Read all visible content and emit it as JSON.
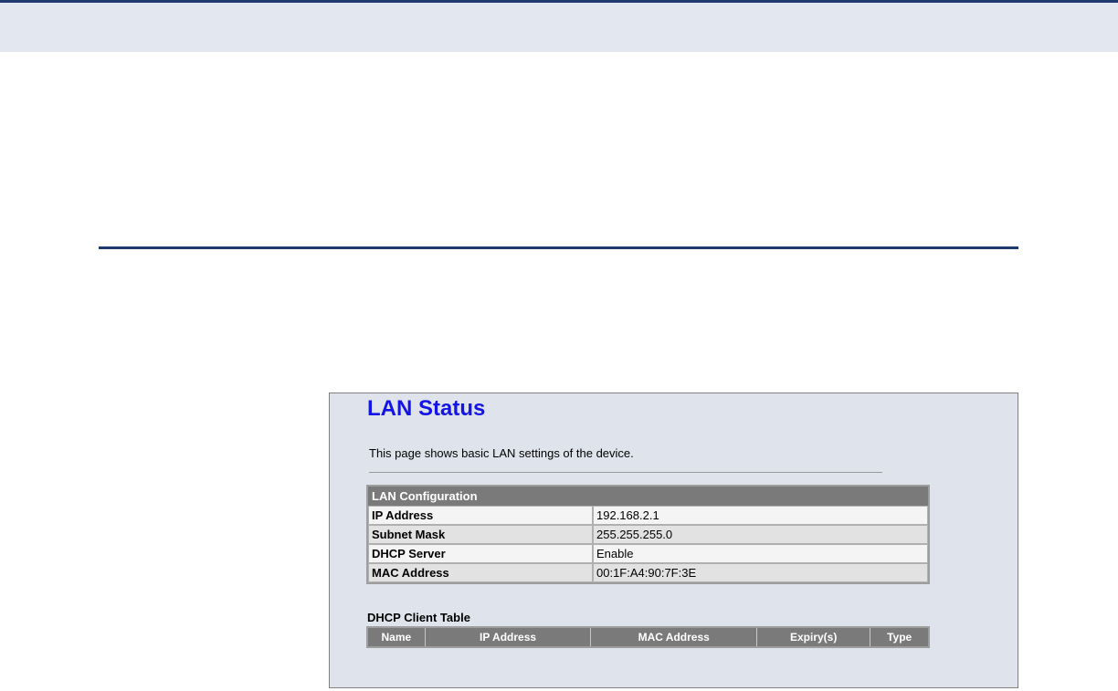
{
  "panel": {
    "title": "LAN Status",
    "description": "This page shows basic LAN settings of the device."
  },
  "lan_config": {
    "header": "LAN Configuration",
    "rows": [
      {
        "label": "IP Address",
        "value": "192.168.2.1"
      },
      {
        "label": "Subnet Mask",
        "value": "255.255.255.0"
      },
      {
        "label": "DHCP Server",
        "value": "Enable"
      },
      {
        "label": "MAC Address",
        "value": "00:1F:A4:90:7F:3E"
      }
    ]
  },
  "dhcp_clients": {
    "caption": "DHCP Client Table",
    "columns": [
      "Name",
      "IP Address",
      "MAC Address",
      "Expiry(s)",
      "Type"
    ]
  },
  "colors": {
    "title": "#1414e6",
    "header_bg": "#7a7a7a",
    "panel_bg": "#dfe4ec",
    "rule": "#1f3a6e"
  }
}
